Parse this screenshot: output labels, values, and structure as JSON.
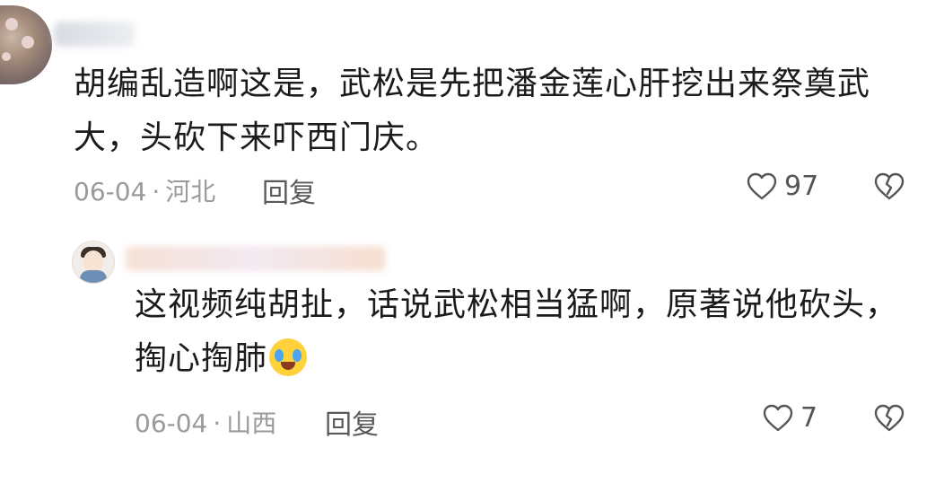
{
  "comments": [
    {
      "text": "胡编乱造啊这是，武松是先把潘金莲心肝挖出来祭奠武大，头砍下来吓西门庆。",
      "date": "06-04",
      "location": "河北",
      "reply_label": "回复",
      "likes": "97",
      "like_icon": "heart-outline-icon",
      "dislike_icon": "broken-heart-icon"
    },
    {
      "text": "这视频纯胡扯，话说武松相当猛啊，原著说他砍头，掏心掏肺",
      "emoji": "crying-laughing-emoji",
      "date": "06-04",
      "location": "山西",
      "reply_label": "回复",
      "likes": "7",
      "like_icon": "heart-outline-icon",
      "dislike_icon": "broken-heart-icon"
    }
  ],
  "colors": {
    "text": "#1b1b1b",
    "meta": "#9a9a9a",
    "emoji": "#ffd23c"
  }
}
